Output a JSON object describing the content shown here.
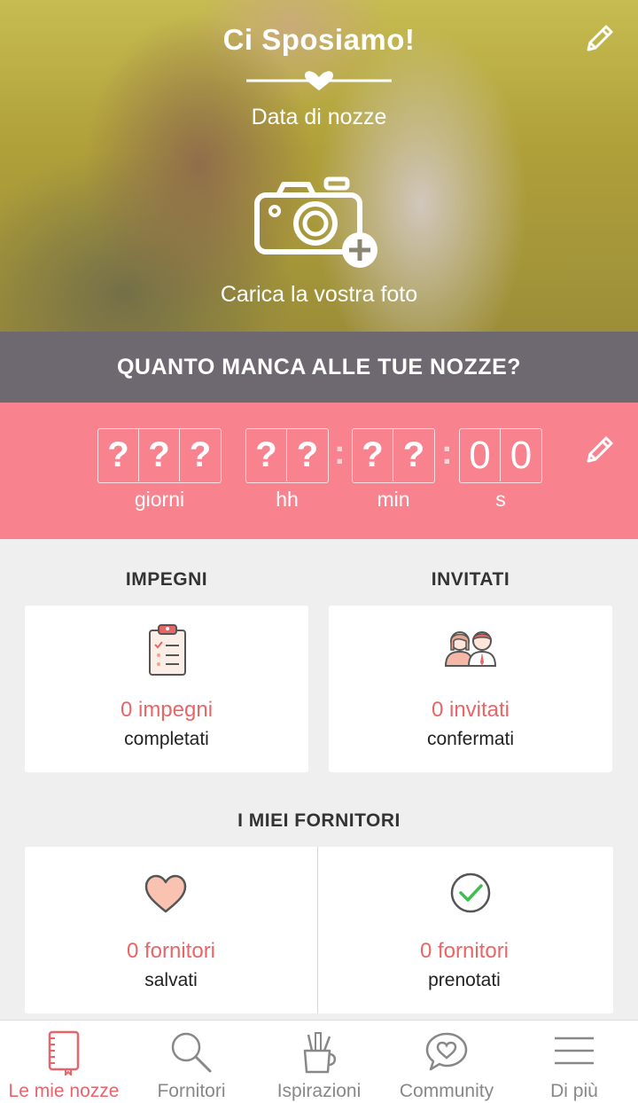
{
  "hero": {
    "title": "Ci Sposiamo!",
    "date_placeholder": "Data di nozze",
    "upload_label": "Carica la vostra foto"
  },
  "countdown": {
    "header": "QUANTO MANCA ALLE TUE NOZZE?",
    "days_digits": [
      "?",
      "?",
      "?"
    ],
    "hours_digits": [
      "?",
      "?"
    ],
    "minutes_digits": [
      "?",
      "?"
    ],
    "seconds_digits": [
      "0",
      "0"
    ],
    "separator": ":",
    "days_label": "giorni",
    "hours_label": "hh",
    "minutes_label": "min",
    "seconds_label": "s"
  },
  "tasks": {
    "title": "IMPEGNI",
    "count": "0 impegni",
    "sub": "completati"
  },
  "guests": {
    "title": "INVITATI",
    "count": "0 invitati",
    "sub": "confermati"
  },
  "vendors": {
    "title": "I MIEI FORNITORI",
    "saved_count": "0 fornitori",
    "saved_sub": "salvati",
    "booked_count": "0 fornitori",
    "booked_sub": "prenotati"
  },
  "nav": [
    {
      "label": "Le mie nozze",
      "icon": "notebook-icon",
      "active": true
    },
    {
      "label": "Fornitori",
      "icon": "search-icon",
      "active": false
    },
    {
      "label": "Ispirazioni",
      "icon": "pencil-cup-icon",
      "active": false
    },
    {
      "label": "Community",
      "icon": "chat-heart-icon",
      "active": false
    },
    {
      "label": "Di più",
      "icon": "menu-icon",
      "active": false
    }
  ],
  "colors": {
    "accent": "#e9636b",
    "countdown_bg": "#f8838f",
    "header_bg": "#6e6870",
    "count_text": "#e96667"
  }
}
